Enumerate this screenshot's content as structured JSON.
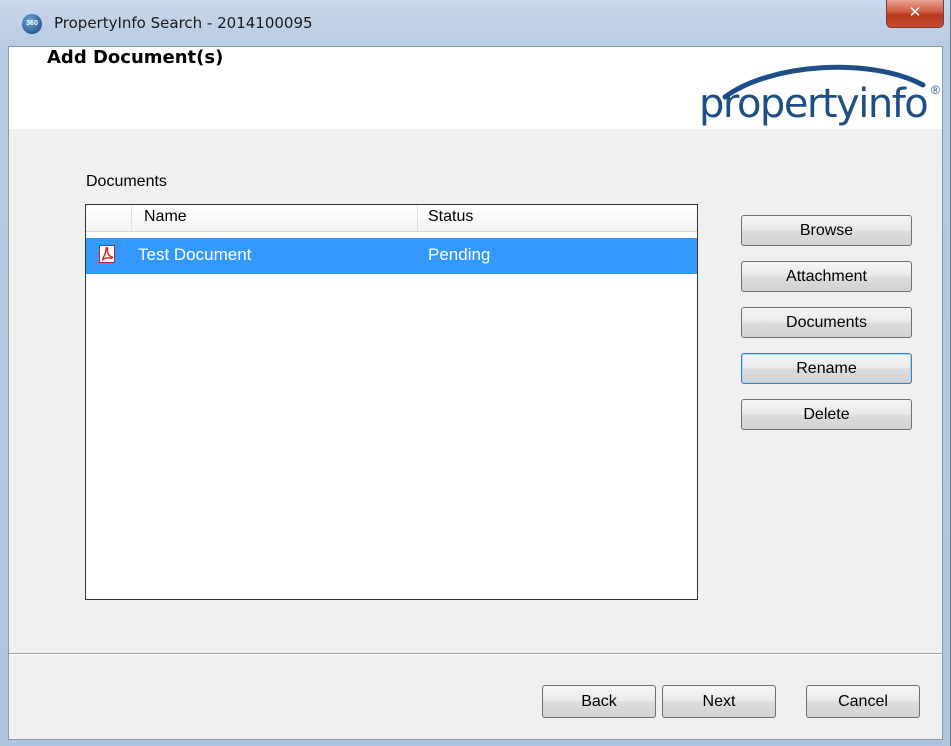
{
  "window": {
    "title": "PropertyInfo Search - 2014100095",
    "app_icon_text": "360",
    "close_symbol": "✕"
  },
  "header": {
    "page_title": "Add Document(s)",
    "logo_text": "propertyinfo",
    "logo_reg": "®"
  },
  "documents": {
    "section_label": "Documents",
    "columns": [
      "Name",
      "Status"
    ],
    "rows": [
      {
        "icon": "pdf-icon",
        "name": "Test Document",
        "status": "Pending",
        "selected": true
      }
    ]
  },
  "side_buttons": {
    "browse": "Browse",
    "attachment": "Attachment",
    "documents": "Documents",
    "rename": "Rename",
    "delete": "Delete"
  },
  "footer_buttons": {
    "back": "Back",
    "next": "Next",
    "cancel": "Cancel"
  },
  "colors": {
    "selection": "#3399ff",
    "logo_blue": "#1d4f86",
    "close_red": "#c74a30"
  }
}
